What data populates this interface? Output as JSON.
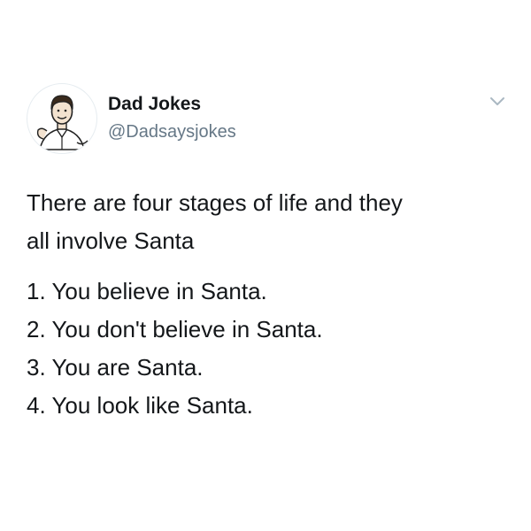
{
  "author": {
    "display_name": "Dad Jokes",
    "handle": "@Dadsaysjokes",
    "avatar_icon": "cartoon-man-avatar-icon"
  },
  "menu": {
    "icon": "chevron-down-icon"
  },
  "tweet": {
    "intro_line_1": "There are four stages of life and they",
    "intro_line_2": "all involve Santa",
    "items": [
      "1. You believe in Santa.",
      "2. You don't believe in Santa.",
      "3. You are Santa.",
      "4. You look like Santa."
    ]
  },
  "colors": {
    "text_primary": "#14171a",
    "text_secondary": "#657786",
    "chevron": "#aab8c2"
  }
}
